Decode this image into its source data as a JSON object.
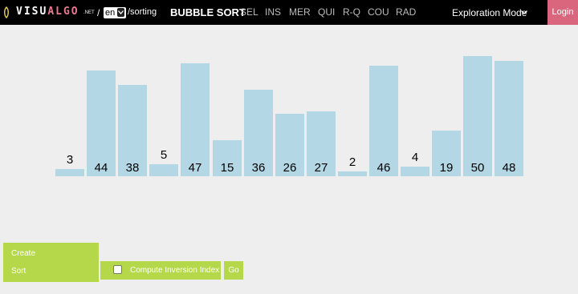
{
  "header": {
    "logo_parts": [
      "VISU",
      "ALGO"
    ],
    "logo_suffix": ".NET",
    "path_slash": "/",
    "language": "en",
    "path": "/sorting",
    "active_algorithm": "BUBBLE SORT",
    "nav_items": [
      "SEL",
      "INS",
      "MER",
      "QUI",
      "R-Q",
      "COU",
      "RAD"
    ],
    "mode_label": "Exploration Mode",
    "login_label": "Login"
  },
  "array": {
    "values": [
      3,
      44,
      38,
      5,
      47,
      15,
      36,
      26,
      27,
      2,
      46,
      4,
      19,
      50,
      48
    ],
    "bar_color": "#b3d7e5"
  },
  "controls": {
    "menu_items": [
      "Create",
      "Sort"
    ],
    "inversion_label": "Compute Inversion Index",
    "inversion_checked": false,
    "go_label": "Go"
  },
  "colors": {
    "topbar": "#000000",
    "login": "#d9667c",
    "controls": "#b5d84b",
    "background": "#eeeeee"
  }
}
